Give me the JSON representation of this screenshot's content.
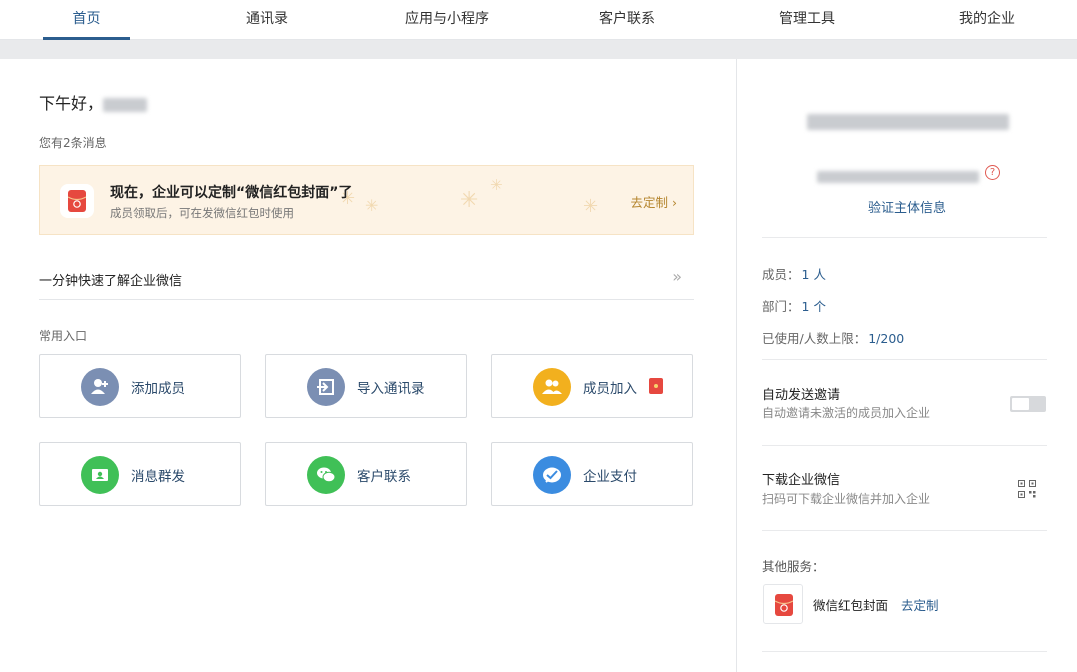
{
  "nav": {
    "items": [
      "首页",
      "通讯录",
      "应用与小程序",
      "客户联系",
      "管理工具",
      "我的企业"
    ],
    "active_index": 0
  },
  "main": {
    "greeting": "下午好，",
    "message_count": "您有2条消息",
    "banner": {
      "title": "现在，企业可以定制“微信红包封面”了",
      "subtitle": "成员领取后，可在发微信红包时使用",
      "link": "去定制 ›"
    },
    "quick_intro": {
      "label": "一分钟快速了解企业微信",
      "arrow": "»"
    },
    "common_entries_label": "常用入口",
    "entries": [
      {
        "label": "添加成员",
        "icon": "add-user-icon",
        "color": "#7b8fb3"
      },
      {
        "label": "导入通讯录",
        "icon": "import-icon",
        "color": "#7b8fb3"
      },
      {
        "label": "成员加入",
        "icon": "members-icon",
        "color": "#f2b01e"
      },
      {
        "label": "消息群发",
        "icon": "broadcast-icon",
        "color": "#40c057"
      },
      {
        "label": "客户联系",
        "icon": "wechat-icon",
        "color": "#40c057"
      },
      {
        "label": "企业支付",
        "icon": "payment-icon",
        "color": "#3b8ce0"
      }
    ]
  },
  "side": {
    "help_glyph": "?",
    "verify_link": "验证主体信息",
    "stats": {
      "members_label": "成员：",
      "members_value": "1 人",
      "departments_label": "部门：",
      "departments_value": "1 个",
      "limit_label": "已使用/人数上限：",
      "limit_value": "1/200"
    },
    "auto_invite": {
      "title": "自动发送邀请",
      "subtitle": "自动邀请未激活的成员加入企业",
      "enabled": false
    },
    "download": {
      "title": "下载企业微信",
      "subtitle": "扫码可下载企业微信并加入企业"
    },
    "other_services_label": "其他服务：",
    "service": {
      "name": "微信红包封面",
      "link": "去定制"
    }
  },
  "colors": {
    "accent": "#2b5d8e",
    "red_envelope": "#e6483f",
    "banner_bg": "#fdf3e5"
  }
}
